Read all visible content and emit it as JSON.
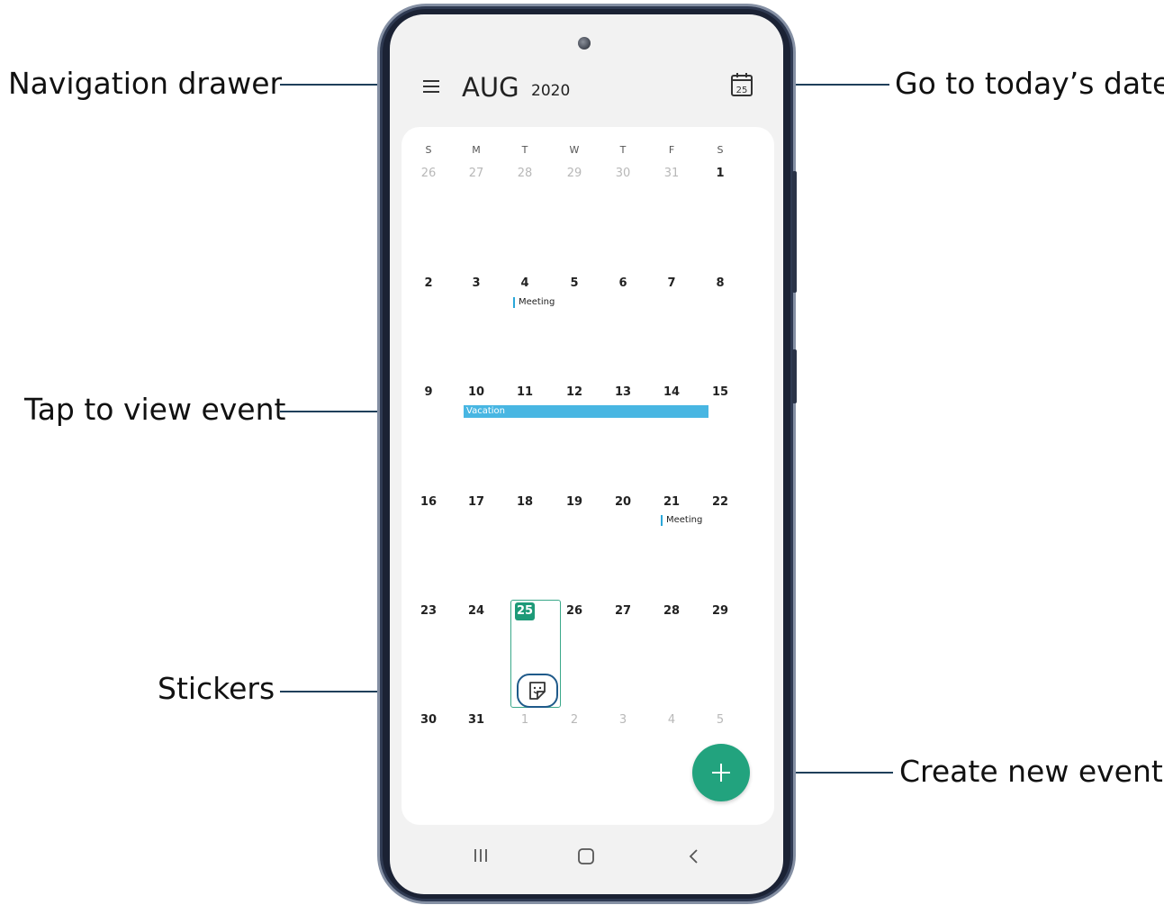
{
  "callouts": {
    "navigation_drawer": "Navigation drawer",
    "go_to_today": "Go to today’s date",
    "tap_to_view_event": "Tap to view event",
    "stickers": "Stickers",
    "create_new_event": "Create new event"
  },
  "header": {
    "month": "AUG",
    "year": "2020",
    "today_icon_day": "25"
  },
  "weekdays": [
    "S",
    "M",
    "T",
    "W",
    "T",
    "F",
    "S"
  ],
  "weeks": [
    [
      {
        "d": "26",
        "dim": true
      },
      {
        "d": "27",
        "dim": true
      },
      {
        "d": "28",
        "dim": true
      },
      {
        "d": "29",
        "dim": true
      },
      {
        "d": "30",
        "dim": true
      },
      {
        "d": "31",
        "dim": true
      },
      {
        "d": "1"
      }
    ],
    [
      {
        "d": "2"
      },
      {
        "d": "3"
      },
      {
        "d": "4"
      },
      {
        "d": "5"
      },
      {
        "d": "6"
      },
      {
        "d": "7"
      },
      {
        "d": "8"
      }
    ],
    [
      {
        "d": "9"
      },
      {
        "d": "10"
      },
      {
        "d": "11"
      },
      {
        "d": "12"
      },
      {
        "d": "13"
      },
      {
        "d": "14"
      },
      {
        "d": "15"
      }
    ],
    [
      {
        "d": "16"
      },
      {
        "d": "17"
      },
      {
        "d": "18"
      },
      {
        "d": "19"
      },
      {
        "d": "20"
      },
      {
        "d": "21"
      },
      {
        "d": "22"
      }
    ],
    [
      {
        "d": "23"
      },
      {
        "d": "24"
      },
      {
        "d": "25",
        "today": true
      },
      {
        "d": "26"
      },
      {
        "d": "27"
      },
      {
        "d": "28"
      },
      {
        "d": "29"
      }
    ],
    [
      {
        "d": "30"
      },
      {
        "d": "31"
      },
      {
        "d": "1",
        "dim": true
      },
      {
        "d": "2",
        "dim": true
      },
      {
        "d": "3",
        "dim": true
      },
      {
        "d": "4",
        "dim": true
      },
      {
        "d": "5",
        "dim": true
      }
    ]
  ],
  "events": {
    "meeting_aug4": "Meeting",
    "meeting_aug21": "Meeting",
    "vacation": "Vacation"
  },
  "colors": {
    "accent_green": "#22a37e",
    "event_blue": "#48b6e2",
    "callout_line": "#1f3f5a"
  },
  "icons": {
    "menu": "hamburger-menu-icon",
    "today": "calendar-today-icon",
    "sticker": "sticker-icon",
    "fab": "plus-icon",
    "nav_recents": "recents-icon",
    "nav_home": "home-icon",
    "nav_back": "back-icon"
  }
}
